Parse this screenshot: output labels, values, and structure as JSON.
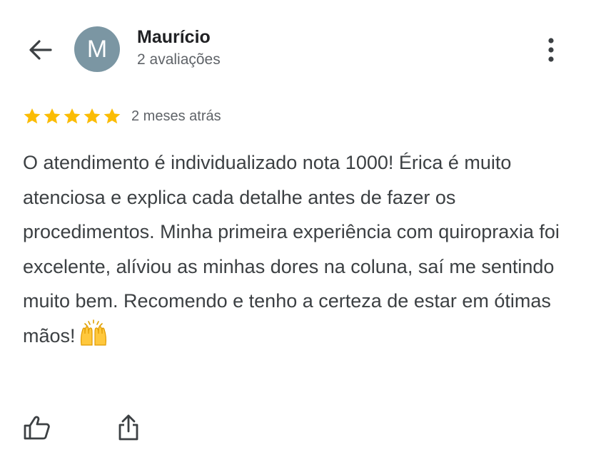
{
  "reviewer": {
    "name": "Maurício",
    "avatar_initial": "M",
    "review_count": "2 avaliações",
    "avatar_color": "#7b96a3"
  },
  "review": {
    "rating": 5,
    "max_rating": 5,
    "date": "2 meses atrás",
    "text": "O atendimento é individualizado nota 1000! Érica é muito atenciosa e explica cada detalhe antes de fazer os procedimentos. Minha primeira experiência com quiropraxia foi excelente, alíviou as minhas dores na coluna, saí me sentindo muito bem. Recomendo e tenho a certeza de estar em ótimas mãos!",
    "emoji": "raising-hands-emoji"
  },
  "icons": {
    "back": "arrow-back-icon",
    "more": "more-vert-icon",
    "star": "star-icon",
    "like": "thumbs-up-icon",
    "share": "share-icon"
  },
  "colors": {
    "star": "#fbbc04",
    "text": "#3c4043",
    "secondary_text": "#5f6368",
    "name": "#202124"
  }
}
